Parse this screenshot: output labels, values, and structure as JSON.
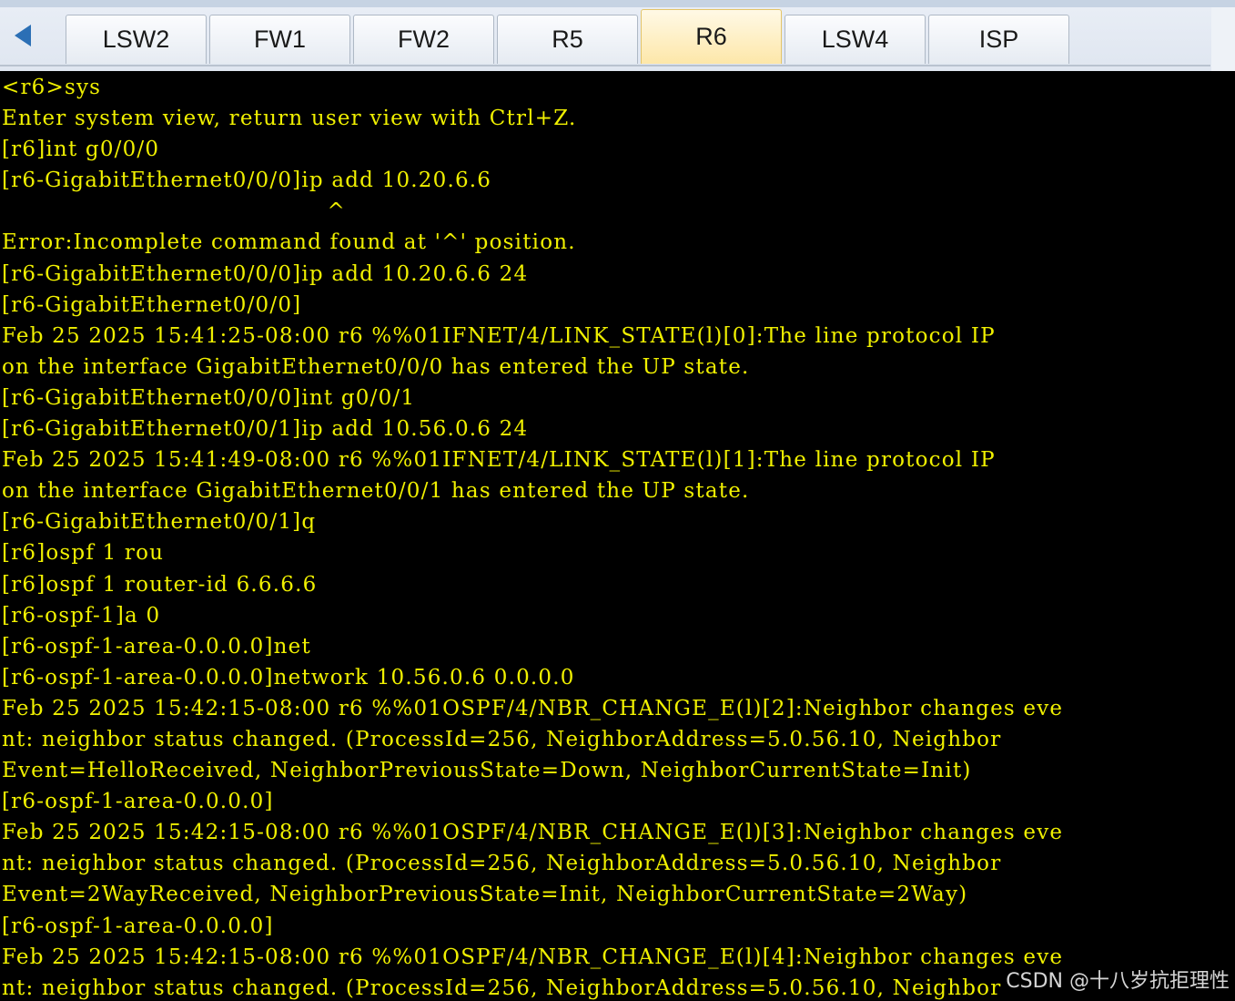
{
  "tabs": [
    {
      "label": "LSW2",
      "active": false
    },
    {
      "label": "FW1",
      "active": false
    },
    {
      "label": "FW2",
      "active": false
    },
    {
      "label": "R5",
      "active": false
    },
    {
      "label": "R6",
      "active": true
    },
    {
      "label": "LSW4",
      "active": false
    },
    {
      "label": "ISP",
      "active": false
    }
  ],
  "colors": {
    "terminal_bg": "#000000",
    "terminal_text": "#f0f000",
    "active_tab": "#fde7a9"
  },
  "terminal": {
    "lines": [
      "<r6>sys",
      "Enter system view, return user view with Ctrl+Z.",
      "[r6]int g0/0/0",
      "[r6-GigabitEthernet0/0/0]ip add 10.20.6.6",
      "                                          ^",
      "Error:Incomplete command found at '^' position.",
      "[r6-GigabitEthernet0/0/0]ip add 10.20.6.6 24",
      "[r6-GigabitEthernet0/0/0]",
      "Feb 25 2025 15:41:25-08:00 r6 %%01IFNET/4/LINK_STATE(l)[0]:The line protocol IP",
      "on the interface GigabitEthernet0/0/0 has entered the UP state.",
      "[r6-GigabitEthernet0/0/0]int g0/0/1",
      "[r6-GigabitEthernet0/0/1]ip add 10.56.0.6 24",
      "Feb 25 2025 15:41:49-08:00 r6 %%01IFNET/4/LINK_STATE(l)[1]:The line protocol IP",
      "on the interface GigabitEthernet0/0/1 has entered the UP state.",
      "[r6-GigabitEthernet0/0/1]q",
      "[r6]ospf 1 rou",
      "[r6]ospf 1 router-id 6.6.6.6",
      "[r6-ospf-1]a 0",
      "[r6-ospf-1-area-0.0.0.0]net",
      "[r6-ospf-1-area-0.0.0.0]network 10.56.0.6 0.0.0.0",
      "Feb 25 2025 15:42:15-08:00 r6 %%01OSPF/4/NBR_CHANGE_E(l)[2]:Neighbor changes eve",
      "nt: neighbor status changed. (ProcessId=256, NeighborAddress=5.0.56.10, Neighbor",
      "Event=HelloReceived, NeighborPreviousState=Down, NeighborCurrentState=Init)",
      "[r6-ospf-1-area-0.0.0.0]",
      "Feb 25 2025 15:42:15-08:00 r6 %%01OSPF/4/NBR_CHANGE_E(l)[3]:Neighbor changes eve",
      "nt: neighbor status changed. (ProcessId=256, NeighborAddress=5.0.56.10, Neighbor",
      "Event=2WayReceived, NeighborPreviousState=Init, NeighborCurrentState=2Way)",
      "[r6-ospf-1-area-0.0.0.0]",
      "Feb 25 2025 15:42:15-08:00 r6 %%01OSPF/4/NBR_CHANGE_E(l)[4]:Neighbor changes eve",
      "nt: neighbor status changed. (ProcessId=256, NeighborAddress=5.0.56.10, Neighbor"
    ]
  },
  "watermark": "CSDN @十八岁抗拒理性"
}
